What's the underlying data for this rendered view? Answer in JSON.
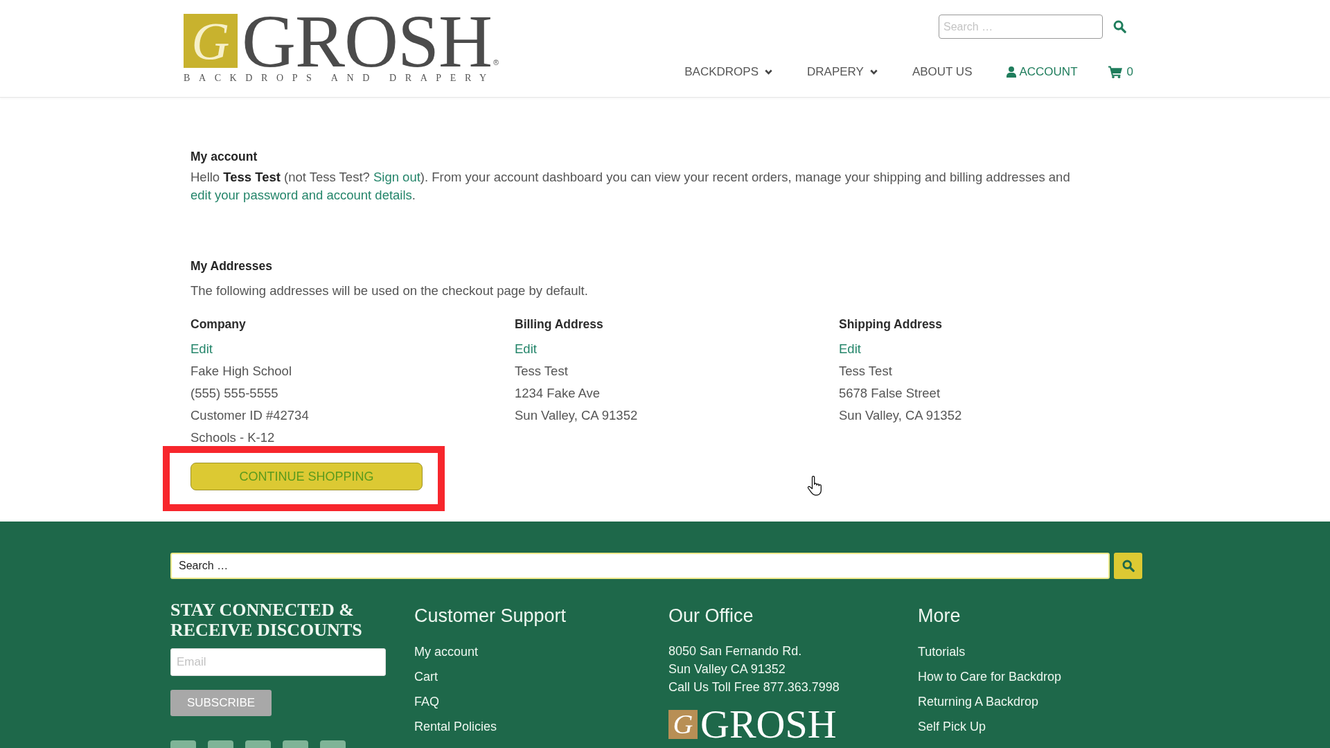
{
  "header": {
    "logo": {
      "monogram": "G",
      "name": "GROSH",
      "registered": "®",
      "tagline": "BACKDROPS AND DRAPERY"
    },
    "search": {
      "placeholder": "Search …"
    },
    "nav": [
      {
        "label": "BACKDROPS",
        "kind": "dropdown",
        "selected": false
      },
      {
        "label": "DRAPERY",
        "kind": "dropdown",
        "selected": false
      },
      {
        "label": "ABOUT US",
        "kind": "link",
        "selected": false
      },
      {
        "label": "ACCOUNT",
        "kind": "account",
        "selected": true
      }
    ],
    "cart": {
      "count": "0"
    }
  },
  "account": {
    "title": "My account",
    "greeting": [
      {
        "kind": "text",
        "text": "Hello **Tess Test** (not Tess Test? "
      },
      {
        "kind": "link",
        "text": "Sign out"
      },
      {
        "kind": "text",
        "text": "). From your account dashboard you can view your recent orders, manage your shipping and billing addresses and "
      },
      {
        "kind": "link",
        "text": "edit your password and account details"
      },
      {
        "kind": "text",
        "text": "."
      }
    ]
  },
  "addresses": {
    "title": "My Addresses",
    "description": "The following addresses will be used on the checkout page by default.",
    "columns": [
      {
        "heading": "Company",
        "edit": "Edit",
        "lines": [
          "Fake High School",
          "(555) 555-5555",
          "Customer ID #42734",
          "Schools - K-12"
        ]
      },
      {
        "heading": "Billing Address",
        "edit": "Edit",
        "lines": [
          "Tess Test",
          "1234 Fake Ave",
          "Sun Valley, CA 91352"
        ]
      },
      {
        "heading": "Shipping Address",
        "edit": "Edit",
        "lines": [
          "Tess Test",
          "5678 False Street",
          "Sun Valley, CA 91352"
        ]
      }
    ]
  },
  "continue_button": {
    "label": "CONTINUE SHOPPING",
    "highlighted": true
  },
  "footer": {
    "search": {
      "placeholder": "Search …"
    },
    "newsletter": {
      "title": "STAY CONNECTED & RECEIVE DISCOUNTS",
      "email_placeholder": "Email",
      "button": "SUBSCRIBE"
    },
    "columns": [
      {
        "heading": "Customer Support",
        "kind": "links",
        "items": [
          "My account",
          "Cart",
          "FAQ",
          "Rental Policies"
        ]
      },
      {
        "heading": "Our Office",
        "kind": "address",
        "items": [
          "8050 San Fernando Rd.",
          "Sun Valley CA 91352",
          "Call Us Toll Free 877.363.7998"
        ],
        "logo": {
          "monogram": "G",
          "name": "GROSH"
        }
      },
      {
        "heading": "More",
        "kind": "links",
        "items": [
          "Tutorials",
          "How to Care for Backdrop",
          "Returning A Backdrop",
          "Self Pick Up"
        ]
      }
    ]
  }
}
